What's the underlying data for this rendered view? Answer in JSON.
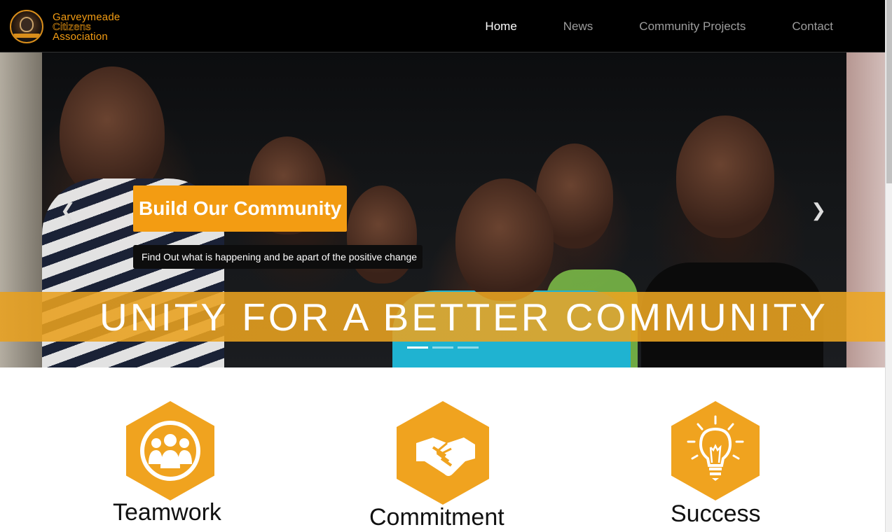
{
  "brand": {
    "line1": "Garveymeade",
    "line2": "Citizens",
    "line3": "Association"
  },
  "nav": [
    {
      "label": "Home",
      "active": true
    },
    {
      "label": "News"
    },
    {
      "label": "Community Projects"
    },
    {
      "label": "Contact"
    }
  ],
  "hero": {
    "title": "Build Our Community",
    "subtitle": "Find Out what is happening  and be apart of the positive change",
    "banner": "UNITY FOR A BETTER COMMUNITY",
    "prev_icon": "chevron-left-icon",
    "next_icon": "chevron-right-icon",
    "slide_count": 3,
    "active_slide": 1
  },
  "features": [
    {
      "title": "Teamwork",
      "icon": "team-icon"
    },
    {
      "title": "Commitment",
      "icon": "handshake-icon"
    },
    {
      "title": "Success",
      "icon": "lightbulb-icon"
    }
  ],
  "colors": {
    "accent": "#f39c12",
    "hex": "#f0a31f",
    "nav_bg": "#000000"
  }
}
